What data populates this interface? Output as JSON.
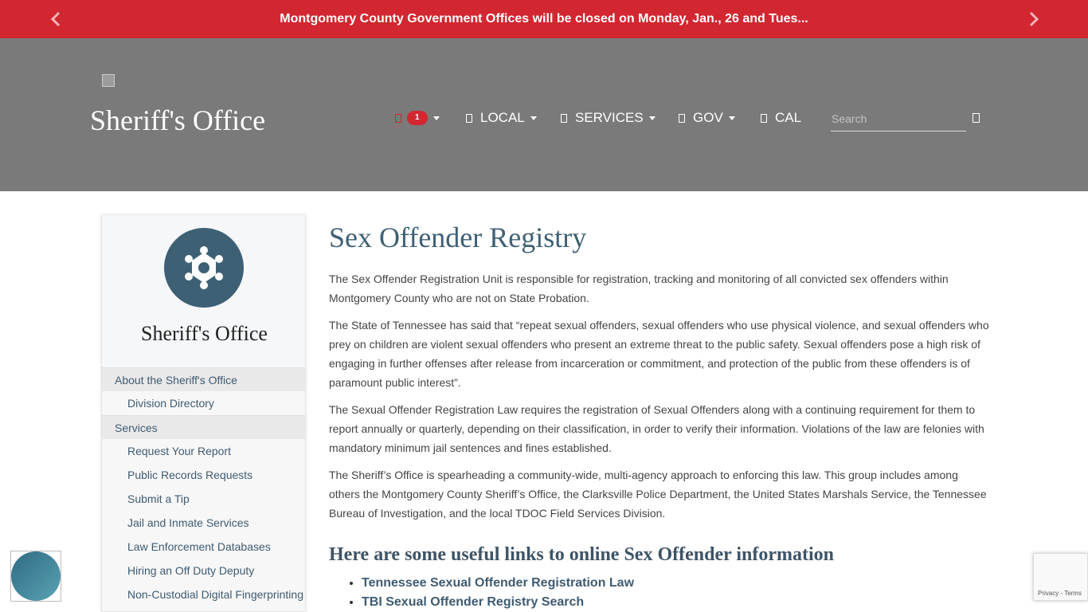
{
  "alert": {
    "text": "Montgomery County Government Offices will be closed on Monday, Jan., 26 and Tues..."
  },
  "header": {
    "site_title": "Sheriff's Office",
    "notifications_count": "1",
    "nav": [
      {
        "label": "LOCAL"
      },
      {
        "label": "SERVICES"
      },
      {
        "label": "GOV"
      },
      {
        "label": "CAL"
      }
    ],
    "search_placeholder": "Search"
  },
  "sidebar": {
    "dept_title": "Sheriff's Office",
    "menu": [
      {
        "label": "About the Sheriff's Office",
        "level": "section"
      },
      {
        "label": "Division Directory",
        "level": "sub"
      },
      {
        "label": "Services",
        "level": "section"
      },
      {
        "label": "Request Your Report",
        "level": "sub"
      },
      {
        "label": "Public Records Requests",
        "level": "sub"
      },
      {
        "label": "Submit a Tip",
        "level": "sub"
      },
      {
        "label": "Jail and Inmate Services",
        "level": "sub"
      },
      {
        "label": "Law Enforcement Databases",
        "level": "sub"
      },
      {
        "label": "Hiring an Off Duty Deputy",
        "level": "sub"
      },
      {
        "label": "Non-Custodial Digital Fingerprinting",
        "level": "sub"
      }
    ]
  },
  "main": {
    "title": "Sex Offender Registry",
    "paragraphs": [
      "The Sex Offender Registration Unit is responsible for registration, tracking and monitoring of all convicted sex offenders within Montgomery County who are not on State Probation.",
      "The State of Tennessee has said that “repeat sexual offenders, sexual offenders who use physical violence, and sexual offenders who prey on children are violent sexual offenders who present an extreme threat to the public safety. Sexual offenders pose a high risk of engaging in further offenses after release from incarceration or commitment, and protection of the public from these offenders is of paramount public interest”.",
      "The Sexual Offender Registration Law requires the registration of Sexual Offenders along with a continuing requirement for them to report annually or quarterly, depending on their classification, in order to verify their information. Violations of the law are felonies with mandatory minimum jail sentences and fines established.",
      "The Sheriff’s Office is spearheading a community-wide, multi-agency approach to enforcing this law. This group includes among others the Montgomery County Sheriff’s Office, the Clarksville Police Department, the United States Marshals Service, the Tennessee Bureau of Investigation, and the local TDOC Field Services Division."
    ],
    "links_heading": "Here are some useful links to online Sex Offender information",
    "links": [
      "Tennessee Sexual Offender Registration Law",
      "TBI Sexual Offender Registry Search"
    ]
  },
  "recaptcha": {
    "terms": "Privacy - Terms"
  },
  "colors": {
    "alert_red": "#d22630",
    "header_gray": "#7a7a7a",
    "accent_blue": "#3e6075"
  }
}
